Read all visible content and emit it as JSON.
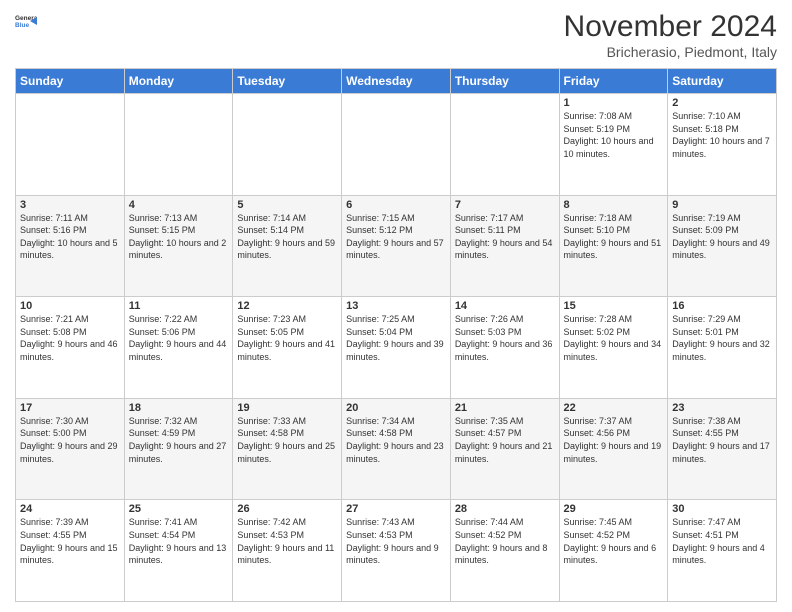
{
  "logo": {
    "general": "General",
    "blue": "Blue"
  },
  "header": {
    "month": "November 2024",
    "location": "Bricherasio, Piedmont, Italy"
  },
  "weekdays": [
    "Sunday",
    "Monday",
    "Tuesday",
    "Wednesday",
    "Thursday",
    "Friday",
    "Saturday"
  ],
  "weeks": [
    [
      {
        "day": "",
        "info": ""
      },
      {
        "day": "",
        "info": ""
      },
      {
        "day": "",
        "info": ""
      },
      {
        "day": "",
        "info": ""
      },
      {
        "day": "",
        "info": ""
      },
      {
        "day": "1",
        "info": "Sunrise: 7:08 AM\nSunset: 5:19 PM\nDaylight: 10 hours and 10 minutes."
      },
      {
        "day": "2",
        "info": "Sunrise: 7:10 AM\nSunset: 5:18 PM\nDaylight: 10 hours and 7 minutes."
      }
    ],
    [
      {
        "day": "3",
        "info": "Sunrise: 7:11 AM\nSunset: 5:16 PM\nDaylight: 10 hours and 5 minutes."
      },
      {
        "day": "4",
        "info": "Sunrise: 7:13 AM\nSunset: 5:15 PM\nDaylight: 10 hours and 2 minutes."
      },
      {
        "day": "5",
        "info": "Sunrise: 7:14 AM\nSunset: 5:14 PM\nDaylight: 9 hours and 59 minutes."
      },
      {
        "day": "6",
        "info": "Sunrise: 7:15 AM\nSunset: 5:12 PM\nDaylight: 9 hours and 57 minutes."
      },
      {
        "day": "7",
        "info": "Sunrise: 7:17 AM\nSunset: 5:11 PM\nDaylight: 9 hours and 54 minutes."
      },
      {
        "day": "8",
        "info": "Sunrise: 7:18 AM\nSunset: 5:10 PM\nDaylight: 9 hours and 51 minutes."
      },
      {
        "day": "9",
        "info": "Sunrise: 7:19 AM\nSunset: 5:09 PM\nDaylight: 9 hours and 49 minutes."
      }
    ],
    [
      {
        "day": "10",
        "info": "Sunrise: 7:21 AM\nSunset: 5:08 PM\nDaylight: 9 hours and 46 minutes."
      },
      {
        "day": "11",
        "info": "Sunrise: 7:22 AM\nSunset: 5:06 PM\nDaylight: 9 hours and 44 minutes."
      },
      {
        "day": "12",
        "info": "Sunrise: 7:23 AM\nSunset: 5:05 PM\nDaylight: 9 hours and 41 minutes."
      },
      {
        "day": "13",
        "info": "Sunrise: 7:25 AM\nSunset: 5:04 PM\nDaylight: 9 hours and 39 minutes."
      },
      {
        "day": "14",
        "info": "Sunrise: 7:26 AM\nSunset: 5:03 PM\nDaylight: 9 hours and 36 minutes."
      },
      {
        "day": "15",
        "info": "Sunrise: 7:28 AM\nSunset: 5:02 PM\nDaylight: 9 hours and 34 minutes."
      },
      {
        "day": "16",
        "info": "Sunrise: 7:29 AM\nSunset: 5:01 PM\nDaylight: 9 hours and 32 minutes."
      }
    ],
    [
      {
        "day": "17",
        "info": "Sunrise: 7:30 AM\nSunset: 5:00 PM\nDaylight: 9 hours and 29 minutes."
      },
      {
        "day": "18",
        "info": "Sunrise: 7:32 AM\nSunset: 4:59 PM\nDaylight: 9 hours and 27 minutes."
      },
      {
        "day": "19",
        "info": "Sunrise: 7:33 AM\nSunset: 4:58 PM\nDaylight: 9 hours and 25 minutes."
      },
      {
        "day": "20",
        "info": "Sunrise: 7:34 AM\nSunset: 4:58 PM\nDaylight: 9 hours and 23 minutes."
      },
      {
        "day": "21",
        "info": "Sunrise: 7:35 AM\nSunset: 4:57 PM\nDaylight: 9 hours and 21 minutes."
      },
      {
        "day": "22",
        "info": "Sunrise: 7:37 AM\nSunset: 4:56 PM\nDaylight: 9 hours and 19 minutes."
      },
      {
        "day": "23",
        "info": "Sunrise: 7:38 AM\nSunset: 4:55 PM\nDaylight: 9 hours and 17 minutes."
      }
    ],
    [
      {
        "day": "24",
        "info": "Sunrise: 7:39 AM\nSunset: 4:55 PM\nDaylight: 9 hours and 15 minutes."
      },
      {
        "day": "25",
        "info": "Sunrise: 7:41 AM\nSunset: 4:54 PM\nDaylight: 9 hours and 13 minutes."
      },
      {
        "day": "26",
        "info": "Sunrise: 7:42 AM\nSunset: 4:53 PM\nDaylight: 9 hours and 11 minutes."
      },
      {
        "day": "27",
        "info": "Sunrise: 7:43 AM\nSunset: 4:53 PM\nDaylight: 9 hours and 9 minutes."
      },
      {
        "day": "28",
        "info": "Sunrise: 7:44 AM\nSunset: 4:52 PM\nDaylight: 9 hours and 8 minutes."
      },
      {
        "day": "29",
        "info": "Sunrise: 7:45 AM\nSunset: 4:52 PM\nDaylight: 9 hours and 6 minutes."
      },
      {
        "day": "30",
        "info": "Sunrise: 7:47 AM\nSunset: 4:51 PM\nDaylight: 9 hours and 4 minutes."
      }
    ]
  ]
}
